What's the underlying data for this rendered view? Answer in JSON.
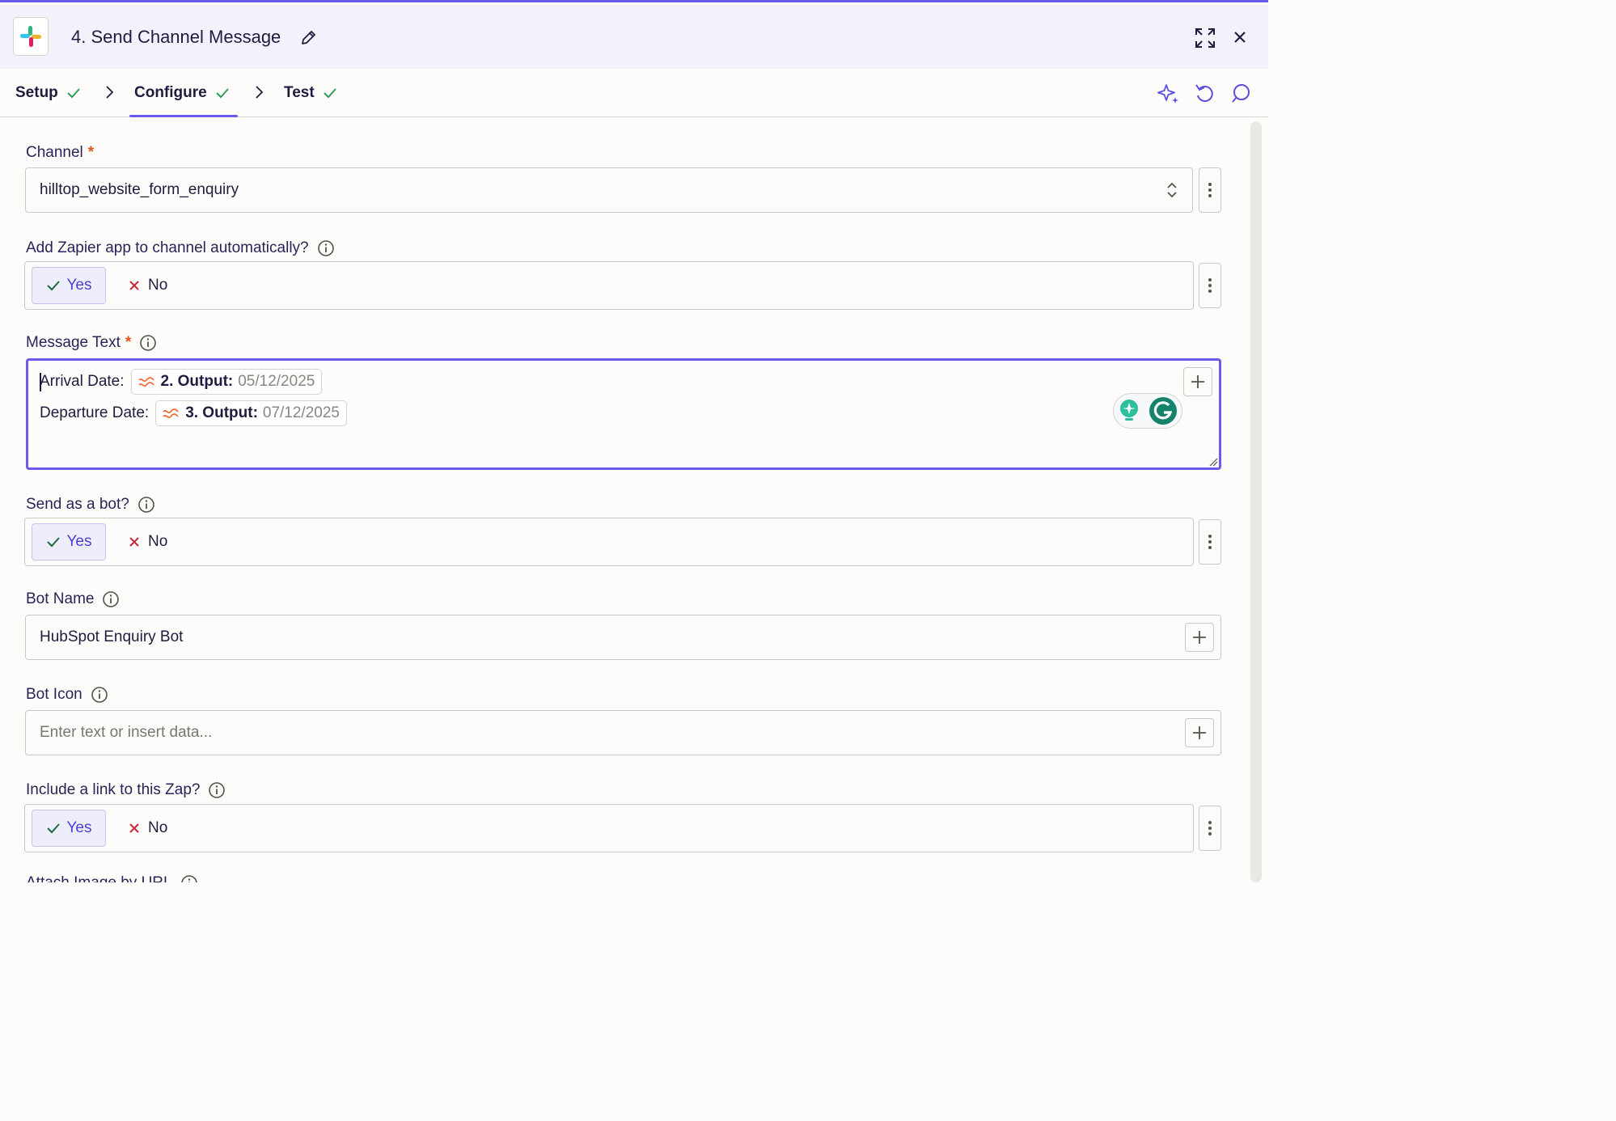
{
  "header": {
    "title": "4. Send Channel Message",
    "app_icon": "slack-logo"
  },
  "tabs": [
    {
      "label": "Setup",
      "status": "complete"
    },
    {
      "label": "Configure",
      "status": "complete",
      "active": true
    },
    {
      "label": "Test",
      "status": "complete"
    }
  ],
  "toolbar_icons": [
    "sparkle-icon",
    "undo-icon",
    "comment-icon"
  ],
  "fields": {
    "channel": {
      "label": "Channel",
      "required": "*",
      "value": "hilltop_website_form_enquiry"
    },
    "add_app": {
      "label": "Add Zapier app to channel automatically?",
      "yes": "Yes",
      "no": "No",
      "selected": "Yes"
    },
    "message": {
      "label": "Message Text",
      "required": "*",
      "lines": [
        {
          "prefix": "Arrival Date:",
          "step": "2. Output:",
          "value": "05/12/2025"
        },
        {
          "prefix": "Departure Date:",
          "step": "3. Output:",
          "value": "07/12/2025"
        }
      ]
    },
    "send_as_bot": {
      "label": "Send as a bot?",
      "yes": "Yes",
      "no": "No",
      "selected": "Yes"
    },
    "bot_name": {
      "label": "Bot Name",
      "value": "HubSpot Enquiry Bot"
    },
    "bot_icon": {
      "label": "Bot Icon",
      "placeholder": "Enter text or insert data..."
    },
    "include_link": {
      "label": "Include a link to this Zap?",
      "yes": "Yes",
      "no": "No",
      "selected": "Yes"
    },
    "attach_image": {
      "label": "Attach Image by URL"
    }
  },
  "colors": {
    "accent": "#695be8",
    "success": "#2f9e5a",
    "required": "#e0541c",
    "no_x": "#c22a3a",
    "formatter": "#f06a35"
  }
}
